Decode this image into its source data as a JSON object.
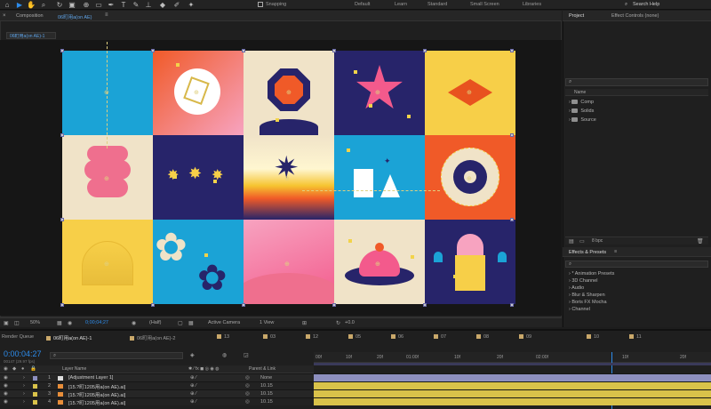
{
  "toolbar": {
    "snapping_label": "Snapping",
    "workspaces": [
      "Default",
      "Learn",
      "Standard",
      "Small Screen",
      "Libraries"
    ],
    "search_placeholder": "Search Help"
  },
  "composition": {
    "tab_title": "Composition",
    "tab_comp_name": "06町用a(on AE)",
    "breadcrumb": "06町用a(on AE)-1",
    "zoom": "50%",
    "timecode": "0;00;04;27",
    "resolution": "(Half)",
    "camera": "Active Camera",
    "views": "1 View",
    "offset": "+0.0"
  },
  "project_panel": {
    "tab_project": "Project",
    "tab_effect_controls": "Effect Controls (none)",
    "column_name": "Name",
    "items": [
      "Comp",
      "Solids",
      "Source"
    ],
    "footer_bpc": "8 bpc"
  },
  "effects_panel": {
    "title": "Effects & Presets",
    "items": [
      "* Animation Presets",
      "3D Channel",
      "Audio",
      "Blur & Sharpen",
      "Boris FX Mocha",
      "Channel"
    ]
  },
  "timeline": {
    "tabs": [
      "Render Queue",
      "06町用a(on AE)-1",
      "06町用a(on AE)-2",
      "13",
      "03",
      "12",
      "05",
      "06",
      "07",
      "08",
      "09",
      "10",
      "11"
    ],
    "timecode": "0:00:04:27",
    "fps_info": "00147 (29.97 fps)",
    "col_layer_name": "Layer Name",
    "col_parent": "Parent & Link",
    "ruler_labels": [
      "00f",
      "10f",
      "20f",
      "01:00f",
      "10f",
      "20f",
      "02:00f",
      "10f",
      "20f"
    ],
    "layers": [
      {
        "num": "1",
        "name": "[Adjustment Layer 1]",
        "parent": "None"
      },
      {
        "num": "2",
        "name": "[15.?町1205用a(on AE).ai]",
        "parent": "10.15"
      },
      {
        "num": "3",
        "name": "[15.?町1205用a(on AE).ai]",
        "parent": "10.15"
      },
      {
        "num": "4",
        "name": "[15.?町1205用a(on AE).ai]",
        "parent": "10.15"
      }
    ]
  },
  "colors": {
    "accent_blue": "#2d8ceb",
    "layer_bar_adjustment": "#8d8fbf",
    "layer_bar_ai": "#d9c24a",
    "timecode_blue": "#2d8ceb"
  },
  "icons": [
    "selection-tool-icon",
    "hand-tool-icon",
    "zoom-tool-icon",
    "rotate-tool-icon",
    "camera-tool-icon",
    "pen-tool-icon",
    "type-tool-icon",
    "brush-tool-icon",
    "stamp-tool-icon",
    "eraser-tool-icon",
    "puppet-tool-icon",
    "search-icon",
    "folder-icon",
    "star-icon",
    "diamond-icon",
    "octagon-icon"
  ]
}
